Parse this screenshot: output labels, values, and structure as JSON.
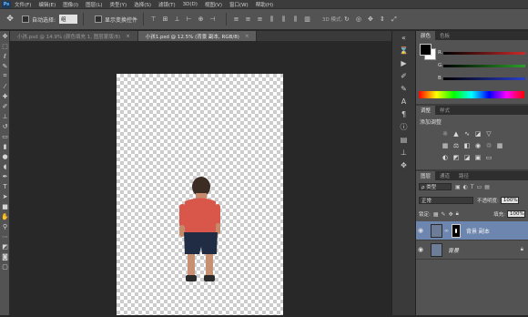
{
  "app": {
    "logo": "Ps"
  },
  "menu": [
    "文件(F)",
    "编辑(E)",
    "图像(I)",
    "图层(L)",
    "类型(Y)",
    "选择(S)",
    "滤镜(T)",
    "3D(D)",
    "视图(V)",
    "窗口(W)",
    "帮助(H)"
  ],
  "options": {
    "auto_select_label": "自动选择:",
    "auto_select_value": "组",
    "show_transform_label": "显示变换控件",
    "mode_3d_label": "3D 模式:"
  },
  "doc_tabs": [
    {
      "title": "小孩.psd @ 14.9% (颜色填充 1, 图层蒙版/8)"
    },
    {
      "title": "小孩1.psd @ 12.5% (背景 副本, RGB/8)"
    }
  ],
  "panels": {
    "color_tabs": [
      "颜色",
      "色板"
    ],
    "sliders": [
      {
        "label": "R",
        "color": "#cc2a2a"
      },
      {
        "label": "G",
        "color": "#2aa02a"
      },
      {
        "label": "B",
        "color": "#2a3ecc"
      }
    ],
    "adjust_tabs": [
      "调整",
      "样式"
    ],
    "adjust_title": "添加调整",
    "layers_tabs": [
      "图层",
      "通道",
      "路径"
    ],
    "kind_filter": "ρ 类型",
    "blend_mode": "正常",
    "opacity_label": "不透明度:",
    "opacity_value": "100%",
    "lock_label": "锁定:",
    "fill_label": "填充:",
    "fill_value": "100%",
    "layers": [
      {
        "name": "背景 副本",
        "selected": true
      },
      {
        "name": "背景",
        "selected": false
      }
    ]
  },
  "colors": {
    "accent": "#6c86b0",
    "panel": "#535353",
    "workspace": "#282828"
  }
}
